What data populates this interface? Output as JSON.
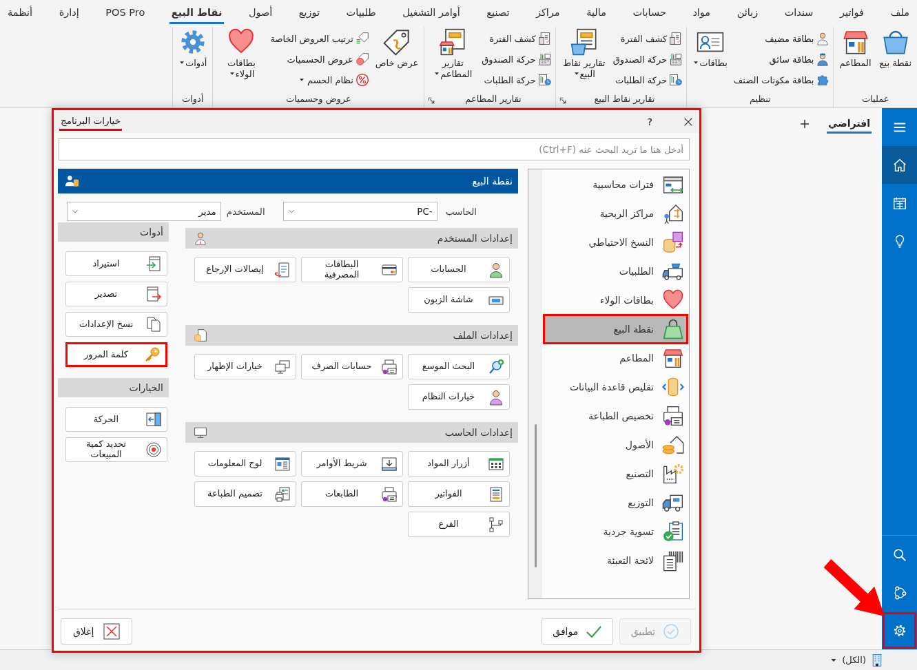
{
  "menu_tabs": [
    {
      "label": "ملف",
      "selected": false
    },
    {
      "label": "فواتير",
      "selected": false
    },
    {
      "label": "سندات",
      "selected": false
    },
    {
      "label": "زبائن",
      "selected": false
    },
    {
      "label": "مواد",
      "selected": false
    },
    {
      "label": "حسابات",
      "selected": false
    },
    {
      "label": "مالية",
      "selected": false
    },
    {
      "label": "مراكز",
      "selected": false
    },
    {
      "label": "تصنيع",
      "selected": false
    },
    {
      "label": "أوامر التشغيل",
      "selected": false
    },
    {
      "label": "طلبيات",
      "selected": false
    },
    {
      "label": "توزيع",
      "selected": false
    },
    {
      "label": "أصول",
      "selected": false
    },
    {
      "label": "نقاط البيع",
      "selected": true
    },
    {
      "label": "POS Pro",
      "selected": false
    },
    {
      "label": "إدارة",
      "selected": false
    },
    {
      "label": "أنظمة",
      "selected": false
    }
  ],
  "ribbon_groups": [
    {
      "title": "عمليات",
      "launcher": false,
      "items": [
        {
          "kind": "large",
          "label": "نقطة بيع",
          "dropdown": false
        },
        {
          "kind": "large",
          "label": "المطاعم",
          "dropdown": false
        }
      ]
    },
    {
      "title": "تنظيم",
      "launcher": false,
      "items": [
        {
          "kind": "stack",
          "entries": [
            {
              "label": "بطاقة مضيف",
              "dropdown": false
            },
            {
              "label": "بطاقة سائق",
              "dropdown": false
            },
            {
              "label": "بطاقة مكونات الصنف",
              "dropdown": false
            }
          ]
        },
        {
          "kind": "large",
          "label": "بطاقات",
          "dropdown": true
        }
      ]
    },
    {
      "title": "تقارير نقاط البيع",
      "launcher": true,
      "items": [
        {
          "kind": "stack",
          "entries": [
            {
              "label": "كشف الفترة",
              "dropdown": false
            },
            {
              "label": "حركة الصندوق",
              "dropdown": false
            },
            {
              "label": "حركة الطلبات",
              "dropdown": false
            }
          ]
        },
        {
          "kind": "large",
          "label": "تقارير نقاط البيع",
          "dropdown": true
        }
      ]
    },
    {
      "title": "تقارير المطاعم",
      "launcher": true,
      "items": [
        {
          "kind": "stack",
          "entries": [
            {
              "label": "كشف الفترة",
              "dropdown": false
            },
            {
              "label": "حركة الصندوق",
              "dropdown": false
            },
            {
              "label": "حركة الطلبات",
              "dropdown": false
            }
          ]
        },
        {
          "kind": "large",
          "label": "تقارير المطاعم",
          "dropdown": true
        }
      ]
    },
    {
      "title": "عروض وحسميات",
      "launcher": false,
      "items": [
        {
          "kind": "large",
          "label": "عرض خاص",
          "dropdown": false
        },
        {
          "kind": "stack",
          "entries": [
            {
              "label": "ترتيب العروض الخاصة",
              "dropdown": false
            },
            {
              "label": "عروض الحسميات",
              "dropdown": false
            },
            {
              "label": "نظام الحسم",
              "dropdown": true
            }
          ]
        },
        {
          "kind": "large",
          "label": "بطاقات الولاء",
          "dropdown": true
        }
      ]
    },
    {
      "title": "أدوات",
      "launcher": false,
      "items": [
        {
          "kind": "large",
          "label": "أدوات",
          "dropdown": true
        }
      ]
    }
  ],
  "workspace": {
    "tabs": [
      {
        "label": "افتراضي",
        "selected": true
      }
    ]
  },
  "rail": {
    "top": [
      {
        "kind": "menu",
        "selected": false,
        "highlighted": false
      },
      {
        "kind": "home",
        "selected": true,
        "highlighted": false
      },
      {
        "kind": "calendar",
        "selected": false,
        "highlighted": false
      },
      {
        "kind": "idea",
        "selected": false,
        "highlighted": false
      }
    ],
    "bottom": [
      {
        "kind": "search",
        "selected": false,
        "highlighted": false
      },
      {
        "kind": "network",
        "selected": false,
        "highlighted": false
      },
      {
        "kind": "settings",
        "selected": false,
        "highlighted": true
      }
    ]
  },
  "status_bar": {
    "filter": "(الكل)"
  },
  "dialog": {
    "title": "خيارات البرنامج",
    "help": "?",
    "highlighted": true,
    "search": {
      "placeholder": "أدخل هنا ما تريد البحث عنه (Ctrl+F)"
    },
    "nav_items": [
      {
        "label": "فترات محاسبية",
        "selected": false,
        "highlighted": false
      },
      {
        "label": "مراكز الربحية",
        "selected": false,
        "highlighted": false
      },
      {
        "label": "النسخ الاحتياطي",
        "selected": false,
        "highlighted": false
      },
      {
        "label": "الطلبيات",
        "selected": false,
        "highlighted": false
      },
      {
        "label": "بطاقات الولاء",
        "selected": false,
        "highlighted": false
      },
      {
        "label": "نقطة البيع",
        "selected": true,
        "highlighted": true
      },
      {
        "label": "المطاعم",
        "selected": false,
        "highlighted": false
      },
      {
        "label": "تقليص قاعدة البيانات",
        "selected": false,
        "highlighted": false
      },
      {
        "label": "تخصيص الطباعة",
        "selected": false,
        "highlighted": false
      },
      {
        "label": "الأصول",
        "selected": false,
        "highlighted": false
      },
      {
        "label": "التصنيع",
        "selected": false,
        "highlighted": false
      },
      {
        "label": "التوزيع",
        "selected": false,
        "highlighted": false
      },
      {
        "label": "تسوية جردية",
        "selected": false,
        "highlighted": false
      },
      {
        "label": "لائحة التعبئة",
        "selected": false,
        "highlighted": false
      }
    ],
    "panel": {
      "title": "نقطة البيع",
      "fields": [
        {
          "label": "الحاسب",
          "value": "-PC"
        },
        {
          "label": "المستخدم",
          "value": "مدير"
        }
      ],
      "sections": [
        {
          "title": "إعدادات المستخدم",
          "buttons": [
            "الحسابات",
            "البطاقات المصرفية",
            "إيصالات الإرجاع",
            "شاشة الزبون"
          ]
        },
        {
          "title": "إعدادات الملف",
          "buttons": [
            "البحث الموسع",
            "حسابات الصرف",
            "خيارات الإظهار",
            "خيارات النظام"
          ]
        },
        {
          "title": "إعدادات الحاسب",
          "buttons": [
            "أزرار المواد",
            "شريط الأوامر",
            "لوح المعلومات",
            "الفواتير",
            "الطابعات",
            "تصميم الطباعة",
            "الفرع"
          ]
        }
      ],
      "side_groups": [
        {
          "title": "أدوات",
          "buttons": [
            {
              "label": "استيراد",
              "highlighted": false
            },
            {
              "label": "تصدير",
              "highlighted": false
            },
            {
              "label": "نسخ الإعدادات",
              "highlighted": false
            },
            {
              "label": "كلمة المرور",
              "highlighted": true
            }
          ]
        },
        {
          "title": "الخيارات",
          "buttons": [
            {
              "label": "الحركة",
              "highlighted": false
            },
            {
              "label": "تحديد كمية المبيعات",
              "highlighted": false
            }
          ]
        }
      ]
    },
    "footer": [
      {
        "label": "تطبيق",
        "disabled": true
      },
      {
        "label": "موافق",
        "disabled": false
      },
      {
        "label": "إغلاق",
        "disabled": false
      }
    ]
  }
}
